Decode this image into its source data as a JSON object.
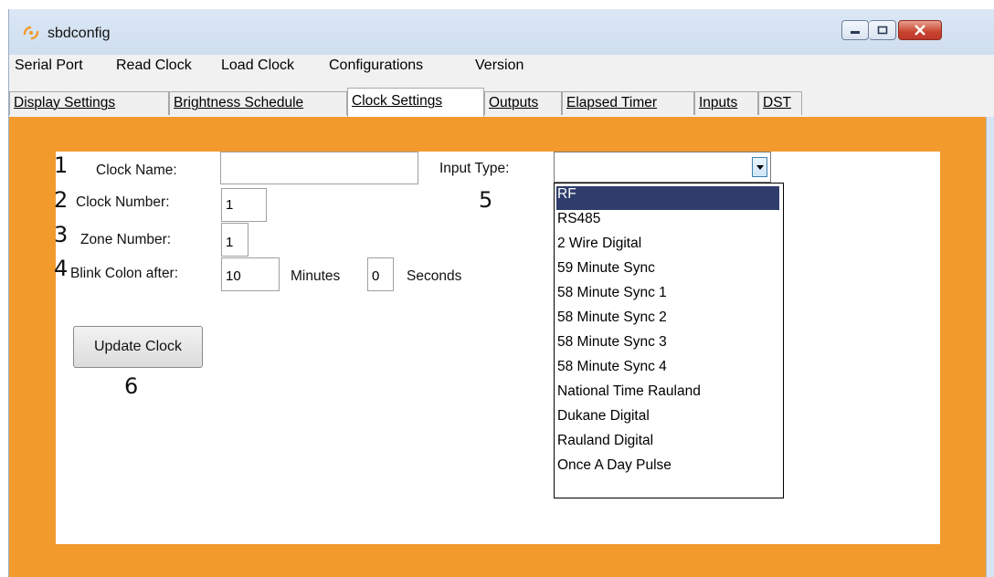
{
  "window": {
    "title": "sbdconfig",
    "app_icon": "sbdconfig-app-icon",
    "buttons": {
      "minimize": "minimize-icon",
      "maximize": "maximize-icon",
      "close": "close-icon"
    }
  },
  "menu": [
    "Serial Port",
    "Read Clock",
    "Load Clock",
    "Configurations",
    "Version"
  ],
  "tabs": [
    "Display Settings",
    "Brightness Schedule",
    "Clock Settings",
    "Outputs",
    "Elapsed Timer",
    "Inputs",
    "DST"
  ],
  "active_tab": "Clock Settings",
  "panel": {
    "accent_color": "#f29a2c",
    "annotations": [
      "1",
      "2",
      "3",
      "4",
      "5",
      "6"
    ],
    "clock_name": {
      "label": "Clock Name:",
      "value": ""
    },
    "clock_number": {
      "label": "Clock Number:",
      "value": "1"
    },
    "zone_number": {
      "label": "Zone Number:",
      "value": "1"
    },
    "blink_colon": {
      "label": "Blink Colon after:",
      "minutes_value": "10",
      "minutes_label": "Minutes",
      "seconds_value": "0",
      "seconds_label": "Seconds"
    },
    "input_type": {
      "label": "Input Type:",
      "value": "",
      "selected": "RF",
      "options": [
        "RF",
        "RS485",
        "2 Wire Digital",
        "59 Minute Sync",
        "58 Minute Sync 1",
        "58 Minute Sync 2",
        "58 Minute Sync 3",
        "58 Minute Sync 4",
        "National Time Rauland",
        "Dukane Digital",
        "Rauland Digital",
        "Once A Day Pulse"
      ]
    },
    "update_button": "Update Clock"
  }
}
